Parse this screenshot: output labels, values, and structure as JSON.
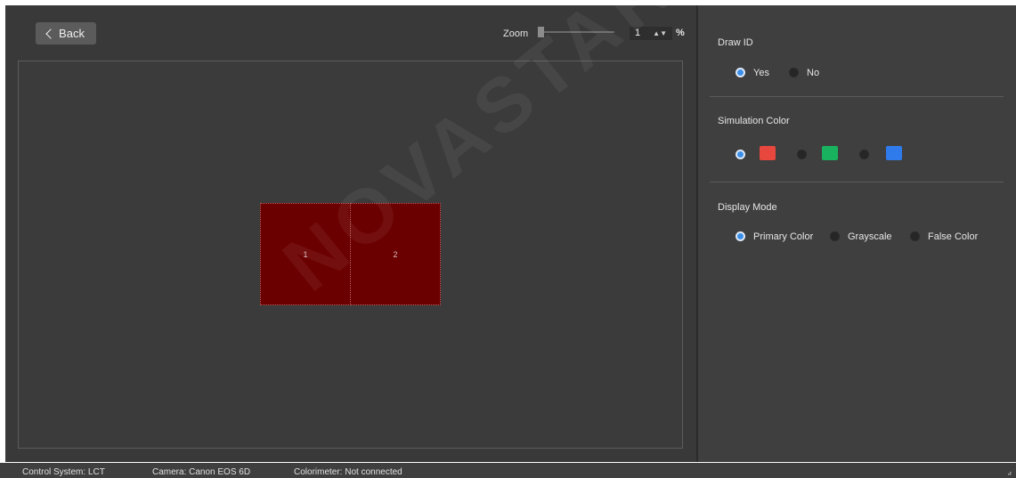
{
  "toolbar": {
    "back_label": "Back",
    "zoom_label": "Zoom",
    "zoom_value": "1",
    "zoom_unit": "%",
    "zoom_slider_level_percent": 1
  },
  "canvas": {
    "cabinets": [
      {
        "id": "1",
        "color": "#6b0000"
      },
      {
        "id": "2",
        "color": "#6b0000"
      }
    ]
  },
  "panel": {
    "draw_id": {
      "title": "Draw ID",
      "options": [
        "Yes",
        "No"
      ],
      "selected": "Yes"
    },
    "simulation_color": {
      "title": "Simulation Color",
      "options": [
        {
          "name": "red",
          "hex": "#e8473d"
        },
        {
          "name": "green",
          "hex": "#19b360"
        },
        {
          "name": "blue",
          "hex": "#2f7bec"
        }
      ],
      "selected": "red"
    },
    "display_mode": {
      "title": "Display Mode",
      "options": [
        "Primary Color",
        "Grayscale",
        "False Color"
      ],
      "selected": "Primary Color"
    }
  },
  "status": {
    "control_system": "Control System:  LCT",
    "camera": "Camera:  Canon EOS 6D",
    "colorimeter": "Colorimeter:  Not connected"
  },
  "watermark": {
    "text": "NOVASTAR TECH CO.,"
  },
  "colors": {
    "accent": "#3b8fe8",
    "cabinet": "#6b0000",
    "background": "#393939",
    "panel": "#3f3f3f"
  }
}
